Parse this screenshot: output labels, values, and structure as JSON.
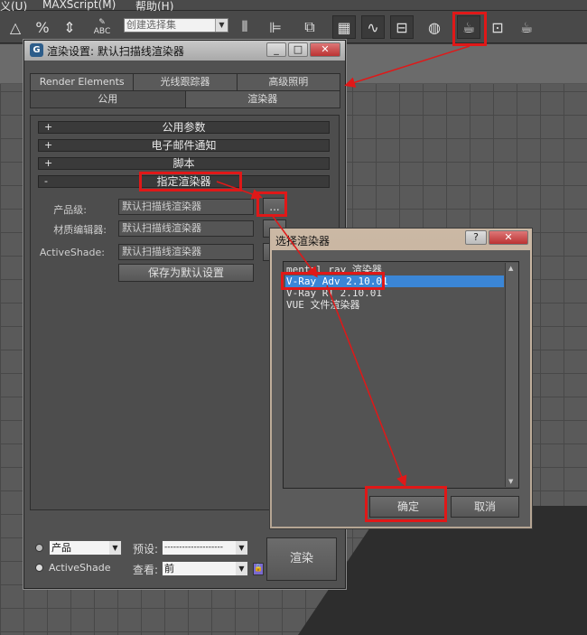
{
  "menubar": {
    "items": [
      "义(U)",
      "MAXScript(M)",
      "帮助(H)"
    ]
  },
  "toolbar": {
    "selection_set": "创建选择集",
    "abc_label": "ABC"
  },
  "render_window": {
    "title": "渲染设置: 默认扫描线渲染器",
    "tabs_row1": [
      "Render Elements",
      "光线跟踪器",
      "高级照明"
    ],
    "tabs_row2": [
      "公用",
      "渲染器"
    ],
    "rollouts": [
      {
        "sign": "+",
        "label": "公用参数"
      },
      {
        "sign": "+",
        "label": "电子邮件通知"
      },
      {
        "sign": "+",
        "label": "脚本"
      },
      {
        "sign": "-",
        "label": "指定渲染器"
      }
    ],
    "assign": {
      "production_label": "产品级:",
      "production_value": "默认扫描线渲染器",
      "material_label": "材质编辑器:",
      "material_value": "默认扫描线渲染器",
      "activeshade_label": "ActiveShade:",
      "activeshade_value": "默认扫描线渲染器",
      "browse_label": "...",
      "save_default": "保存为默认设置"
    },
    "bottom": {
      "production_option": "产品",
      "activeshade_option": "ActiveShade",
      "preset_label": "预设:",
      "preset_value": "--------------------",
      "view_label": "查看:",
      "view_value": "前",
      "render_button": "渲染"
    }
  },
  "chooser_dialog": {
    "title": "选择渲染器",
    "help": "?",
    "close": "✕",
    "items": [
      "mental ray 渲染器",
      "V-Ray Adv 2.10.01",
      "V-Ray RT 2.10.01",
      "VUE 文件渲染器"
    ],
    "selected_index": 1,
    "ok_label": "确定",
    "cancel_label": "取消"
  },
  "colors": {
    "highlight": "#e01818",
    "selection": "#3b86d6"
  }
}
